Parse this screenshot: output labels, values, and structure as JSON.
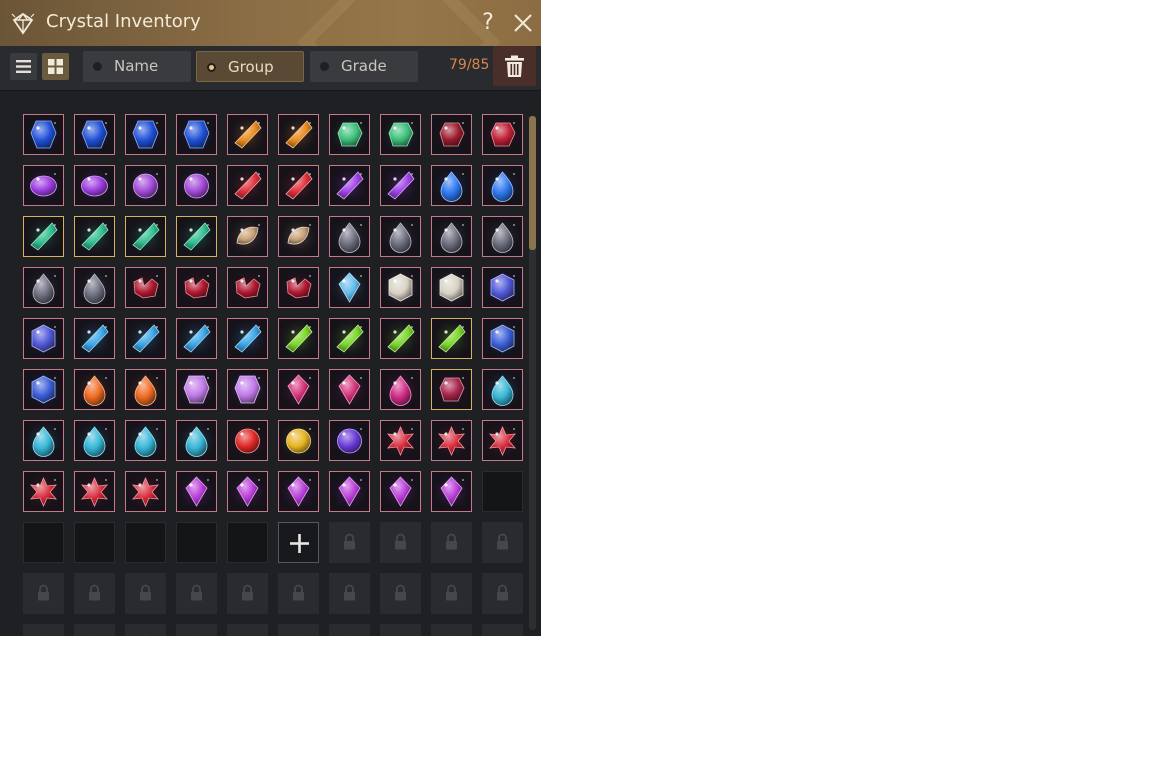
{
  "window": {
    "title": "Crystal Inventory",
    "help_label": "?",
    "icons": {
      "title": "crystal-icon",
      "close": "close-icon",
      "help": "help-icon"
    }
  },
  "toolbar": {
    "view_list_icon": "list-view-icon",
    "view_grid_icon": "grid-view-icon",
    "active_view": "grid",
    "sort_options": [
      {
        "label": "Name",
        "selected": false
      },
      {
        "label": "Group",
        "selected": true
      },
      {
        "label": "Grade",
        "selected": false
      }
    ],
    "count": "79/85",
    "delete_icon": "trash-icon"
  },
  "colors": {
    "count": "#d78652",
    "slot_border": "#c47a86",
    "slot_border_gold": "#d4b35a"
  },
  "slots": [
    {
      "kind": "gem",
      "gem": "blue-crystal",
      "c": "#1e4fd6"
    },
    {
      "kind": "gem",
      "gem": "blue-crystal",
      "c": "#1e4fd6"
    },
    {
      "kind": "gem",
      "gem": "blue-crystal",
      "c": "#1e4fd6"
    },
    {
      "kind": "gem",
      "gem": "blue-crystal",
      "c": "#1e4fd6"
    },
    {
      "kind": "gem",
      "gem": "amber-shard",
      "c": "#e88a1c"
    },
    {
      "kind": "gem",
      "gem": "amber-shard",
      "c": "#e88a1c"
    },
    {
      "kind": "gem",
      "gem": "green-stone",
      "c": "#3bbf7a"
    },
    {
      "kind": "gem",
      "gem": "green-stone",
      "c": "#3bbf7a"
    },
    {
      "kind": "gem",
      "gem": "dark-garnet",
      "c": "#9b1b2c"
    },
    {
      "kind": "gem",
      "gem": "dark-garnet",
      "c": "#c01f35"
    },
    {
      "kind": "gem",
      "gem": "violet-oval",
      "c": "#9b3be0"
    },
    {
      "kind": "gem",
      "gem": "violet-oval",
      "c": "#9b3be0"
    },
    {
      "kind": "gem",
      "gem": "violet-round",
      "c": "#a24ad8"
    },
    {
      "kind": "gem",
      "gem": "violet-round",
      "c": "#a24ad8"
    },
    {
      "kind": "gem",
      "gem": "red-shard",
      "c": "#e0303a"
    },
    {
      "kind": "gem",
      "gem": "red-shard",
      "c": "#e0303a"
    },
    {
      "kind": "gem",
      "gem": "violet-shard",
      "c": "#a042e8"
    },
    {
      "kind": "gem",
      "gem": "violet-shard",
      "c": "#a042e8"
    },
    {
      "kind": "gem",
      "gem": "blue-drop",
      "c": "#2f78f0"
    },
    {
      "kind": "gem",
      "gem": "blue-drop",
      "c": "#2f78f0"
    },
    {
      "kind": "gem",
      "gem": "jade-leaf",
      "c": "#2fbf8e",
      "gold": true
    },
    {
      "kind": "gem",
      "gem": "jade-leaf",
      "c": "#2fbf8e",
      "gold": true
    },
    {
      "kind": "gem",
      "gem": "jade-leaf",
      "c": "#2fbf8e",
      "gold": true
    },
    {
      "kind": "gem",
      "gem": "jade-leaf",
      "c": "#2fbf8e",
      "gold": true
    },
    {
      "kind": "gem",
      "gem": "bone-fossil",
      "c": "#c9a27a"
    },
    {
      "kind": "gem",
      "gem": "bone-fossil",
      "c": "#c9a27a"
    },
    {
      "kind": "gem",
      "gem": "smoky-drop",
      "c": "#6e6f80"
    },
    {
      "kind": "gem",
      "gem": "smoky-drop",
      "c": "#6e6f80"
    },
    {
      "kind": "gem",
      "gem": "smoky-drop",
      "c": "#6e6f80"
    },
    {
      "kind": "gem",
      "gem": "smoky-drop",
      "c": "#6e6f80"
    },
    {
      "kind": "gem",
      "gem": "smoky-drop",
      "c": "#6e6f80"
    },
    {
      "kind": "gem",
      "gem": "smoky-drop",
      "c": "#6e6f80"
    },
    {
      "kind": "gem",
      "gem": "ruby-cluster",
      "c": "#b01830"
    },
    {
      "kind": "gem",
      "gem": "ruby-cluster",
      "c": "#b01830"
    },
    {
      "kind": "gem",
      "gem": "ruby-cluster",
      "c": "#b01830"
    },
    {
      "kind": "gem",
      "gem": "ruby-cluster",
      "c": "#b01830"
    },
    {
      "kind": "gem",
      "gem": "ice-diamond",
      "c": "#5fb8ea"
    },
    {
      "kind": "gem",
      "gem": "white-cube",
      "c": "#d8d2c4"
    },
    {
      "kind": "gem",
      "gem": "white-cube",
      "c": "#d8d2c4"
    },
    {
      "kind": "gem",
      "gem": "indigo-cube",
      "c": "#5058d8"
    },
    {
      "kind": "gem",
      "gem": "indigo-cube",
      "c": "#5058d8"
    },
    {
      "kind": "gem",
      "gem": "cyan-shard",
      "c": "#3aa6e8"
    },
    {
      "kind": "gem",
      "gem": "cyan-shard",
      "c": "#3aa6e8"
    },
    {
      "kind": "gem",
      "gem": "cyan-shard",
      "c": "#3aa6e8"
    },
    {
      "kind": "gem",
      "gem": "cyan-shard",
      "c": "#3aa6e8"
    },
    {
      "kind": "gem",
      "gem": "lime-shard",
      "c": "#7bd62a"
    },
    {
      "kind": "gem",
      "gem": "lime-shard",
      "c": "#7bd62a"
    },
    {
      "kind": "gem",
      "gem": "lime-shard",
      "c": "#7bd62a"
    },
    {
      "kind": "gem",
      "gem": "lime-shard",
      "c": "#7bd62a",
      "gold": true
    },
    {
      "kind": "gem",
      "gem": "sapphire-cube",
      "c": "#3b5fd8"
    },
    {
      "kind": "gem",
      "gem": "sapphire-cube",
      "c": "#3b5fd8"
    },
    {
      "kind": "gem",
      "gem": "flame-drop",
      "c": "#ef6a22"
    },
    {
      "kind": "gem",
      "gem": "flame-drop",
      "c": "#ef6a22"
    },
    {
      "kind": "gem",
      "gem": "lilac-crystal",
      "c": "#c07ae8"
    },
    {
      "kind": "gem",
      "gem": "lilac-crystal",
      "c": "#c07ae8"
    },
    {
      "kind": "gem",
      "gem": "magenta-prism",
      "c": "#d42f7a"
    },
    {
      "kind": "gem",
      "gem": "magenta-prism",
      "c": "#d42f7a"
    },
    {
      "kind": "gem",
      "gem": "magenta-drop",
      "c": "#d02c86"
    },
    {
      "kind": "gem",
      "gem": "garnet-chunk",
      "c": "#a8244a",
      "gold": true
    },
    {
      "kind": "gem",
      "gem": "aqua-drop",
      "c": "#36b6d6"
    },
    {
      "kind": "gem",
      "gem": "aqua-drop",
      "c": "#36b6d6"
    },
    {
      "kind": "gem",
      "gem": "aqua-drop",
      "c": "#36b6d6"
    },
    {
      "kind": "gem",
      "gem": "aqua-drop",
      "c": "#36b6d6"
    },
    {
      "kind": "gem",
      "gem": "aqua-drop",
      "c": "#36b6d6"
    },
    {
      "kind": "gem",
      "gem": "red-orb",
      "c": "#e02828"
    },
    {
      "kind": "gem",
      "gem": "gold-orb",
      "c": "#e6b422"
    },
    {
      "kind": "gem",
      "gem": "purple-orb",
      "c": "#6a3ad8"
    },
    {
      "kind": "gem",
      "gem": "ruby-star",
      "c": "#d8283a"
    },
    {
      "kind": "gem",
      "gem": "ruby-star",
      "c": "#d8283a"
    },
    {
      "kind": "gem",
      "gem": "ruby-star",
      "c": "#d8283a"
    },
    {
      "kind": "gem",
      "gem": "ruby-star",
      "c": "#d8283a"
    },
    {
      "kind": "gem",
      "gem": "ruby-star",
      "c": "#d8283a"
    },
    {
      "kind": "gem",
      "gem": "ruby-star",
      "c": "#d8283a"
    },
    {
      "kind": "gem",
      "gem": "amethyst-diamond",
      "c": "#b83ad8"
    },
    {
      "kind": "gem",
      "gem": "amethyst-diamond",
      "c": "#b83ad8"
    },
    {
      "kind": "gem",
      "gem": "amethyst-diamond",
      "c": "#b83ad8"
    },
    {
      "kind": "gem",
      "gem": "amethyst-diamond",
      "c": "#b83ad8"
    },
    {
      "kind": "gem",
      "gem": "amethyst-diamond",
      "c": "#b83ad8"
    },
    {
      "kind": "gem",
      "gem": "amethyst-diamond",
      "c": "#b83ad8"
    },
    {
      "kind": "empty"
    },
    {
      "kind": "empty"
    },
    {
      "kind": "empty"
    },
    {
      "kind": "empty"
    },
    {
      "kind": "empty"
    },
    {
      "kind": "empty"
    },
    {
      "kind": "add",
      "icon": "plus-icon"
    },
    {
      "kind": "locked",
      "icon": "lock-icon"
    },
    {
      "kind": "locked",
      "icon": "lock-icon"
    },
    {
      "kind": "locked",
      "icon": "lock-icon"
    },
    {
      "kind": "locked",
      "icon": "lock-icon"
    },
    {
      "kind": "locked",
      "icon": "lock-icon"
    },
    {
      "kind": "locked",
      "icon": "lock-icon"
    },
    {
      "kind": "locked",
      "icon": "lock-icon"
    },
    {
      "kind": "locked",
      "icon": "lock-icon"
    },
    {
      "kind": "locked",
      "icon": "lock-icon"
    },
    {
      "kind": "locked",
      "icon": "lock-icon"
    },
    {
      "kind": "locked",
      "icon": "lock-icon"
    },
    {
      "kind": "locked",
      "icon": "lock-icon"
    },
    {
      "kind": "locked",
      "icon": "lock-icon"
    },
    {
      "kind": "locked",
      "icon": "lock-icon"
    },
    {
      "kind": "locked",
      "icon": "lock-icon"
    },
    {
      "kind": "locked",
      "icon": "lock-icon"
    },
    {
      "kind": "locked",
      "icon": "lock-icon"
    },
    {
      "kind": "locked",
      "icon": "lock-icon"
    },
    {
      "kind": "locked",
      "icon": "lock-icon"
    },
    {
      "kind": "locked",
      "icon": "lock-icon"
    },
    {
      "kind": "locked",
      "icon": "lock-icon"
    },
    {
      "kind": "locked",
      "icon": "lock-icon"
    },
    {
      "kind": "locked",
      "icon": "lock-icon"
    },
    {
      "kind": "locked",
      "icon": "lock-icon"
    }
  ]
}
